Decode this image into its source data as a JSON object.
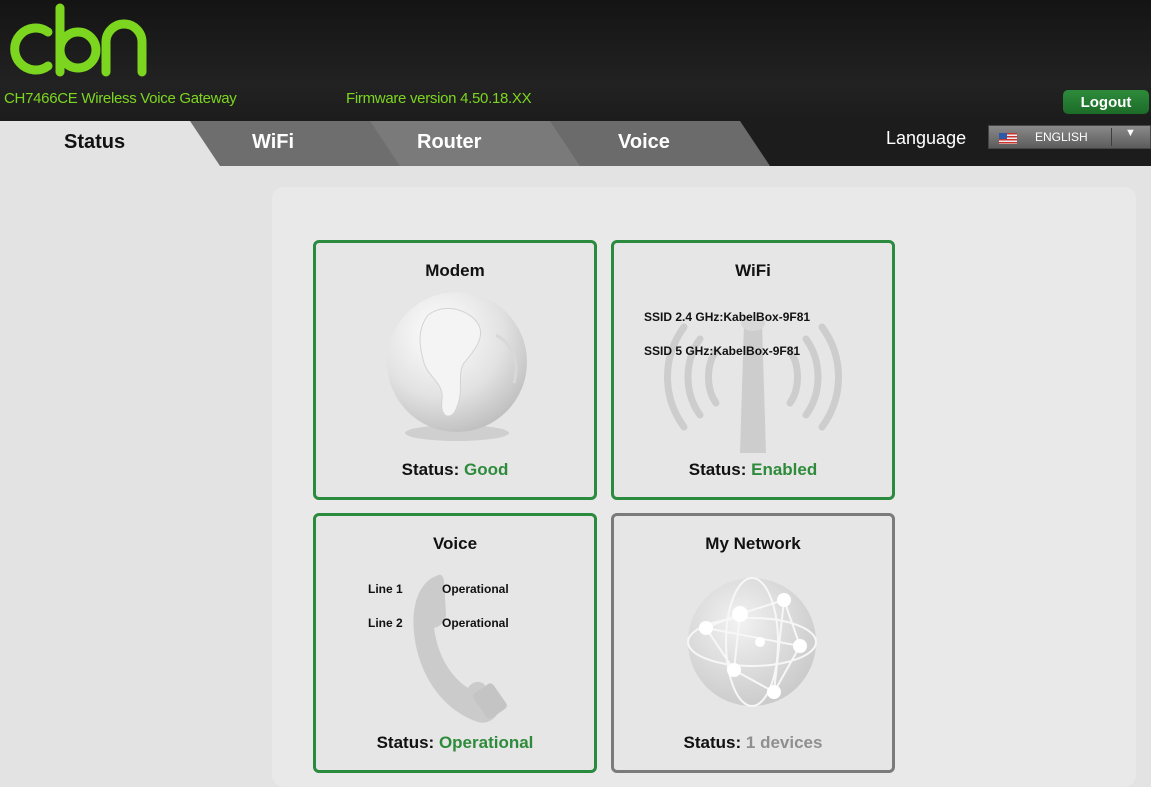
{
  "header": {
    "logo_text": "cbn",
    "model": "CH7466CE  Wireless Voice Gateway",
    "firmware": "Firmware version  4.50.18.XX",
    "logout_label": "Logout"
  },
  "tabs": [
    {
      "label": "Status",
      "active": true
    },
    {
      "label": "WiFi",
      "active": false
    },
    {
      "label": "Router",
      "active": false
    },
    {
      "label": "Voice",
      "active": false
    }
  ],
  "language": {
    "label": "Language",
    "selected": "ENGLISH",
    "flag_icon": "us-flag-icon"
  },
  "colors": {
    "accent_green": "#2e8b3b",
    "header_green": "#7cd61f"
  },
  "cards": {
    "modem": {
      "title": "Modem",
      "status_label": "Status:",
      "status_value": "Good",
      "icon": "globe-icon"
    },
    "wifi": {
      "title": "WiFi",
      "ssid_24": "SSID 2.4 GHz:KabelBox-9F81",
      "ssid_5": "SSID 5 GHz:KabelBox-9F81",
      "status_label": "Status:",
      "status_value": "Enabled",
      "icon": "antenna-icon"
    },
    "voice": {
      "title": "Voice",
      "lines": [
        {
          "name": "Line 1",
          "state": "Operational"
        },
        {
          "name": "Line 2",
          "state": "Operational"
        }
      ],
      "status_label": "Status:",
      "status_value": "Operational",
      "icon": "phone-handset-icon"
    },
    "network": {
      "title": "My Network",
      "status_label": "Status:",
      "status_value": "1 devices",
      "icon": "network-globe-icon"
    }
  }
}
